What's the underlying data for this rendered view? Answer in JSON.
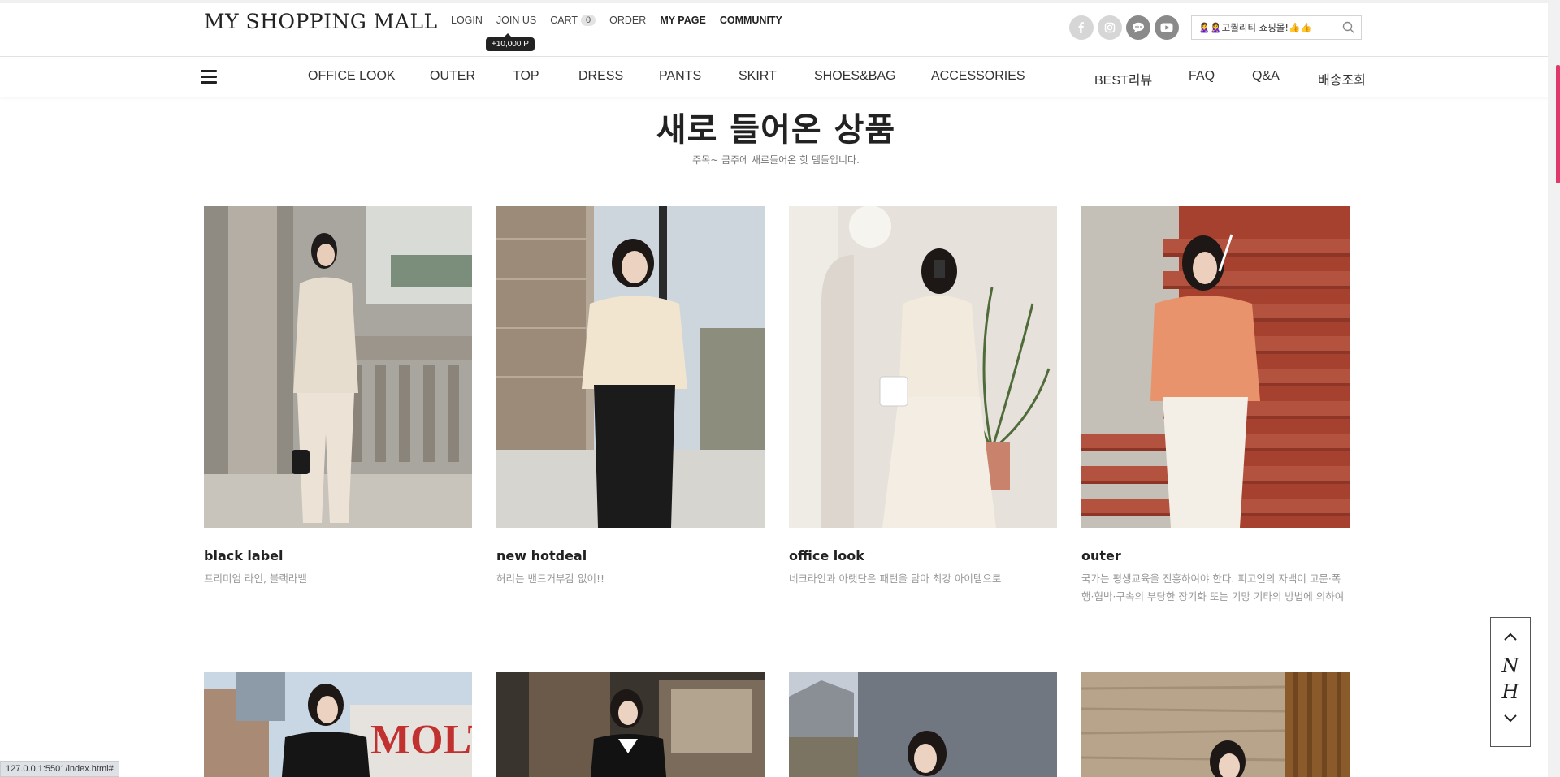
{
  "header": {
    "logo": "MY SHOPPING MALL",
    "links": [
      {
        "label": "LOGIN",
        "bold": false
      },
      {
        "label": "JOIN US",
        "bold": false
      },
      {
        "label": "CART",
        "bold": false,
        "count": "0"
      },
      {
        "label": "ORDER",
        "bold": false
      },
      {
        "label": "MY PAGE",
        "bold": true
      },
      {
        "label": "COMMUNITY",
        "bold": true
      }
    ],
    "join_tooltip": "+10,000 P",
    "social": [
      "facebook-icon",
      "instagram-icon",
      "kakao-talk-icon",
      "youtube-icon"
    ],
    "search_value": "🙎‍♀️🙎‍♀️고퀄리티 쇼핑몰!👍👍"
  },
  "nav": {
    "categories": [
      "OFFICE LOOK",
      "OUTER",
      "TOP",
      "DRESS",
      "PANTS",
      "SKIRT",
      "SHOES&BAG",
      "ACCESSORIES"
    ],
    "utility": [
      "BEST리뷰",
      "FAQ",
      "Q&A",
      "배송조회"
    ]
  },
  "section": {
    "title": "새로 들어온 상품",
    "subtitle": "주목~ 금주에 새로들어온 핫 템들입니다."
  },
  "products": [
    {
      "name": "black label",
      "desc": "프리미엄 라인, 블랙라벨"
    },
    {
      "name": "new hotdeal",
      "desc": "허리는 밴드거부감 없이!!"
    },
    {
      "name": "office look",
      "desc": "네크라인과 아랫단은 패턴을 담아 최강 아이템으로"
    },
    {
      "name": "outer",
      "desc": "국가는 평생교육을 진흥하여야 한다. 피고인의 자백이 고문·폭행·협박·구속의 부당한 장기화 또는 기망 기타의 방법에 의하여"
    }
  ],
  "float_widget": {
    "letters": [
      "N",
      "H"
    ]
  },
  "status_url": "127.0.0.1:5501/index.html#",
  "colors": {
    "accent": "#e0386b",
    "tooltip_bg": "#222222"
  }
}
